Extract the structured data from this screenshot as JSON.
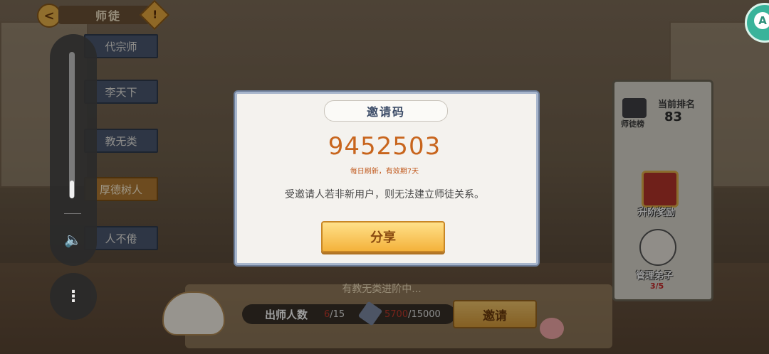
{
  "header": {
    "back_icon": "<",
    "title": "师徒",
    "info_icon": "!"
  },
  "left_tabs": [
    {
      "label": "代宗师",
      "active": false
    },
    {
      "label": "李天下",
      "active": false
    },
    {
      "label": "教无类",
      "active": false
    },
    {
      "label": "厚德树人",
      "active": true
    },
    {
      "label": "人不倦",
      "active": false
    }
  ],
  "system": {
    "volume_icon": "🔈",
    "more_icon": "⋮",
    "volume_level": 0.12
  },
  "right_panel": {
    "board_label": "师徒榜",
    "rank_label": "当前排名",
    "rank_value": "83",
    "reward_label": "升阶奖励",
    "manage_label": "管理弟子",
    "manage_count": "3/5"
  },
  "bottom": {
    "progress_text": "有教无类进阶中...",
    "graduate_label": "出师人数",
    "graduate_current": "6",
    "graduate_total": "/15",
    "exp_current": "5700",
    "exp_total": "/15000",
    "invite_label": "邀请"
  },
  "dialog": {
    "title": "邀请码",
    "code": "9452503",
    "subtitle": "每日刷新，有效期7天",
    "note": "受邀请人若非新用户，则无法建立师徒关系。",
    "share_label": "分享"
  },
  "colors": {
    "code": "#c8651d",
    "accent": "#f4b23b",
    "dialog_border": "#a8b6cc"
  }
}
